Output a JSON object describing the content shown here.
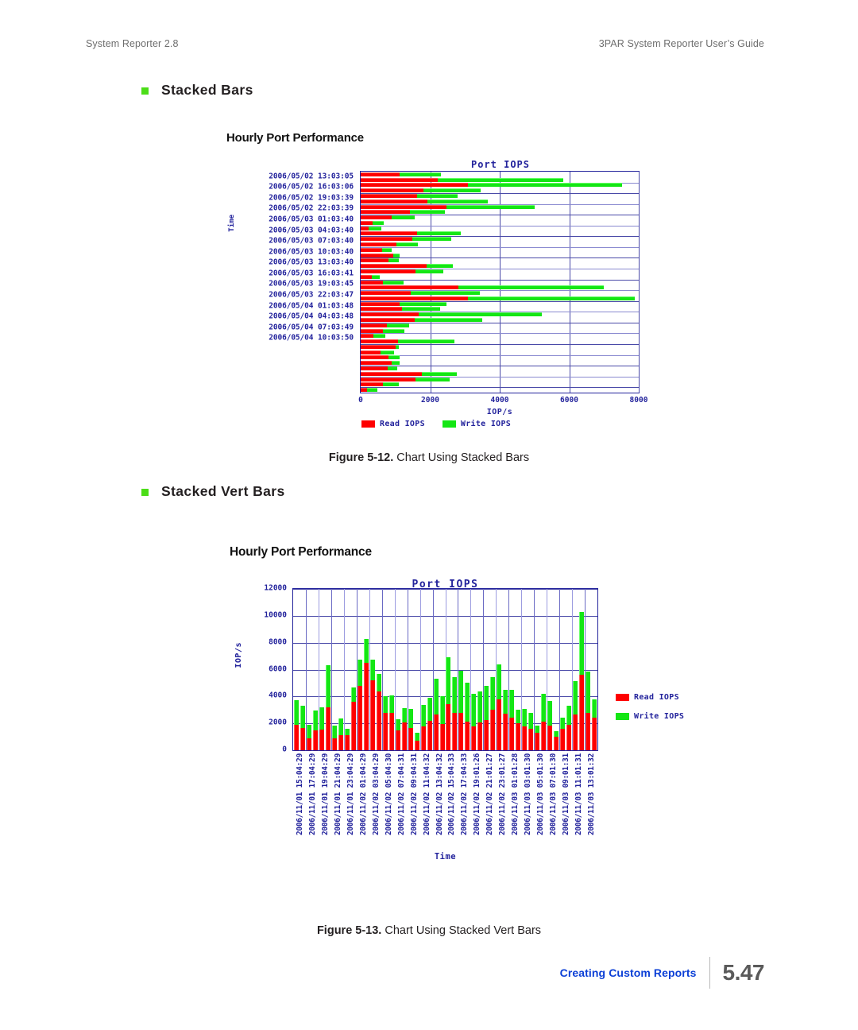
{
  "header": {
    "left": "System Reporter 2.8",
    "right": "3PAR System Reporter User’s Guide"
  },
  "sections": [
    {
      "bullet": "green-square-bullet",
      "title": "Stacked Bars"
    },
    {
      "bullet": "green-square-bullet",
      "title": "Stacked Vert Bars"
    }
  ],
  "figures": [
    {
      "number": "Figure 5-12.",
      "caption": "Chart Using Stacked Bars"
    },
    {
      "number": "Figure 5-13.",
      "caption": "Chart Using Stacked Vert Bars"
    }
  ],
  "footer": {
    "label": "Creating Custom Reports",
    "page": "5.47"
  },
  "colors": {
    "read": "#fe0000",
    "write": "#14e614",
    "axis_text": "#23239c",
    "grid": "#4a4aa8",
    "bullet": "#4cdd18",
    "footer_blue": "#0b3fd6",
    "header_gray": "#6e6e6e"
  },
  "chart_data": [
    {
      "id": "stacked-bars",
      "type": "bar",
      "orientation": "horizontal",
      "report_title": "Hourly Port Performance",
      "title": "Port IOPS",
      "xlabel": "IOP/s",
      "ylabel": "Time",
      "xlim": [
        0,
        8000
      ],
      "xticks": [
        0,
        2000,
        4000,
        6000,
        8000
      ],
      "grid": true,
      "legend": [
        "Read IOPS",
        "Write IOPS"
      ],
      "legend_position": "bottom-left",
      "categories": [
        "2006/05/02 13:03:05",
        "2006/05/02 16:03:06",
        "2006/05/02 19:03:39",
        "2006/05/02 22:03:39",
        "2006/05/03 01:03:40",
        "2006/05/03 04:03:40",
        "2006/05/03 07:03:40",
        "2006/05/03 10:03:40",
        "2006/05/03 13:03:40",
        "2006/05/03 16:03:41",
        "2006/05/03 19:03:45",
        "2006/05/03 22:03:47",
        "2006/05/04 01:03:48",
        "2006/05/04 04:03:48",
        "2006/05/04 07:03:49",
        "2006/05/04 10:03:50"
      ],
      "bars": [
        {
          "read": 1120,
          "write": 1180
        },
        {
          "read": 2220,
          "write": 3600
        },
        {
          "read": 3080,
          "write": 4450
        },
        {
          "read": 1800,
          "write": 1660
        },
        {
          "read": 1620,
          "write": 1170
        },
        {
          "read": 1920,
          "write": 1730
        },
        {
          "read": 2460,
          "write": 2550
        },
        {
          "read": 1410,
          "write": 1020
        },
        {
          "read": 880,
          "write": 680
        },
        {
          "read": 340,
          "write": 320
        },
        {
          "read": 230,
          "write": 360
        },
        {
          "read": 1620,
          "write": 1250
        },
        {
          "read": 1480,
          "write": 1120
        },
        {
          "read": 1020,
          "write": 620
        },
        {
          "read": 620,
          "write": 260
        },
        {
          "read": 930,
          "write": 190
        },
        {
          "read": 800,
          "write": 300
        },
        {
          "read": 1890,
          "write": 750
        },
        {
          "read": 1570,
          "write": 800
        },
        {
          "read": 310,
          "write": 240
        },
        {
          "read": 640,
          "write": 600
        },
        {
          "read": 2800,
          "write": 4200
        },
        {
          "read": 1430,
          "write": 1990
        },
        {
          "read": 3080,
          "write": 4800
        },
        {
          "read": 1120,
          "write": 1340
        },
        {
          "read": 1180,
          "write": 1100
        },
        {
          "read": 1670,
          "write": 3550
        },
        {
          "read": 1550,
          "write": 1940
        },
        {
          "read": 760,
          "write": 640
        },
        {
          "read": 640,
          "write": 620
        },
        {
          "read": 370,
          "write": 330
        },
        {
          "read": 1080,
          "write": 1620
        },
        {
          "read": 1000,
          "write": 100
        },
        {
          "read": 560,
          "write": 400
        },
        {
          "read": 800,
          "write": 330
        },
        {
          "read": 900,
          "write": 230
        },
        {
          "read": 770,
          "write": 280
        },
        {
          "read": 1770,
          "write": 1000
        },
        {
          "read": 1570,
          "write": 1000
        },
        {
          "read": 640,
          "write": 460
        },
        {
          "read": 180,
          "write": 300
        }
      ]
    },
    {
      "id": "stacked-vert-bars",
      "type": "bar",
      "orientation": "vertical",
      "stacked": true,
      "report_title": "Hourly Port Performance",
      "title": "Port IOPS",
      "xlabel": "Time",
      "ylabel": "IOP/s",
      "ylim": [
        0,
        12000
      ],
      "yticks": [
        0,
        2000,
        4000,
        6000,
        8000,
        10000,
        12000
      ],
      "grid": true,
      "legend": [
        "Read IOPS",
        "Write IOPS"
      ],
      "legend_position": "right",
      "tick_labels": [
        "2006/11/01 15:04:29",
        "2006/11/01 17:04:29",
        "2006/11/01 19:04:29",
        "2006/11/01 21:04:29",
        "2006/11/01 23:04:29",
        "2006/11/02 01:04:29",
        "2006/11/02 03:04:29",
        "2006/11/02 05:04:30",
        "2006/11/02 07:04:31",
        "2006/11/02 09:04:31",
        "2006/11/02 11:04:32",
        "2006/11/02 13:04:32",
        "2006/11/02 15:04:33",
        "2006/11/02 17:04:33",
        "2006/11/02 19:01:26",
        "2006/11/02 21:01:27",
        "2006/11/02 23:01:27",
        "2006/11/03 01:01:28",
        "2006/11/03 03:01:30",
        "2006/11/03 05:01:30",
        "2006/11/03 07:01:30",
        "2006/11/03 09:01:31",
        "2006/11/03 11:01:31",
        "2006/11/03 13:01:32"
      ],
      "bars": [
        {
          "read": 1900,
          "write": 1800
        },
        {
          "read": 1650,
          "write": 1650
        },
        {
          "read": 900,
          "write": 1000
        },
        {
          "read": 1450,
          "write": 1500
        },
        {
          "read": 1530,
          "write": 1670
        },
        {
          "read": 3200,
          "write": 3100
        },
        {
          "read": 900,
          "write": 950
        },
        {
          "read": 1100,
          "write": 1250
        },
        {
          "read": 1150,
          "write": 450
        },
        {
          "read": 3600,
          "write": 1100
        },
        {
          "read": 4800,
          "write": 1950
        },
        {
          "read": 6500,
          "write": 1750
        },
        {
          "read": 5200,
          "write": 1550
        },
        {
          "read": 4400,
          "write": 1300
        },
        {
          "read": 2750,
          "write": 1300
        },
        {
          "read": 2800,
          "write": 1300
        },
        {
          "read": 1480,
          "write": 820
        },
        {
          "read": 2080,
          "write": 1070
        },
        {
          "read": 1680,
          "write": 1400
        },
        {
          "read": 700,
          "write": 580
        },
        {
          "read": 1800,
          "write": 1600
        },
        {
          "read": 2180,
          "write": 1700
        },
        {
          "read": 2650,
          "write": 2680
        },
        {
          "read": 1980,
          "write": 2020
        },
        {
          "read": 3400,
          "write": 3500
        },
        {
          "read": 2800,
          "write": 2650
        },
        {
          "read": 2800,
          "write": 3100
        },
        {
          "read": 2100,
          "write": 2900
        },
        {
          "read": 1750,
          "write": 2450
        },
        {
          "read": 2050,
          "write": 2350
        },
        {
          "read": 2250,
          "write": 2550
        },
        {
          "read": 3000,
          "write": 2450
        },
        {
          "read": 3800,
          "write": 2600
        },
        {
          "read": 2700,
          "write": 1800
        },
        {
          "read": 2400,
          "write": 2100
        },
        {
          "read": 2000,
          "write": 1000
        },
        {
          "read": 1750,
          "write": 1350
        },
        {
          "read": 1600,
          "write": 1150
        },
        {
          "read": 1300,
          "write": 550
        },
        {
          "read": 2150,
          "write": 2050
        },
        {
          "read": 1850,
          "write": 1800
        },
        {
          "read": 1000,
          "write": 400
        },
        {
          "read": 1600,
          "write": 800
        },
        {
          "read": 1900,
          "write": 1400
        },
        {
          "read": 2650,
          "write": 2500
        },
        {
          "read": 5600,
          "write": 4700
        },
        {
          "read": 2800,
          "write": 3050
        },
        {
          "read": 2400,
          "write": 1400
        }
      ]
    }
  ]
}
